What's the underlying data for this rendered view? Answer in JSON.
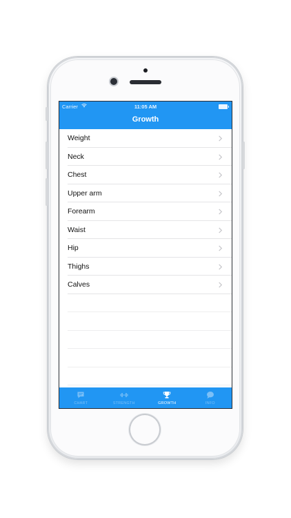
{
  "status_bar": {
    "carrier": "Carrier",
    "time": "11:05 AM"
  },
  "nav": {
    "title": "Growth"
  },
  "list": {
    "items": [
      {
        "label": "Weight"
      },
      {
        "label": "Neck"
      },
      {
        "label": "Chest"
      },
      {
        "label": "Upper arm"
      },
      {
        "label": "Forearm"
      },
      {
        "label": "Waist"
      },
      {
        "label": "Hip"
      },
      {
        "label": "Thighs"
      },
      {
        "label": "Calves"
      }
    ]
  },
  "tab_bar": {
    "tabs": [
      {
        "label": "CHART",
        "icon": "chat-bubble-icon",
        "active": false
      },
      {
        "label": "STRENGTH",
        "icon": "dumbbell-icon",
        "active": false
      },
      {
        "label": "GROWTH",
        "icon": "trophy-icon",
        "active": true
      },
      {
        "label": "INFO",
        "icon": "speech-bubble-icon",
        "active": false
      }
    ]
  },
  "colors": {
    "accent": "#2196f3",
    "tab_inactive": "#7cc0f7",
    "tab_active": "#ffffff"
  }
}
